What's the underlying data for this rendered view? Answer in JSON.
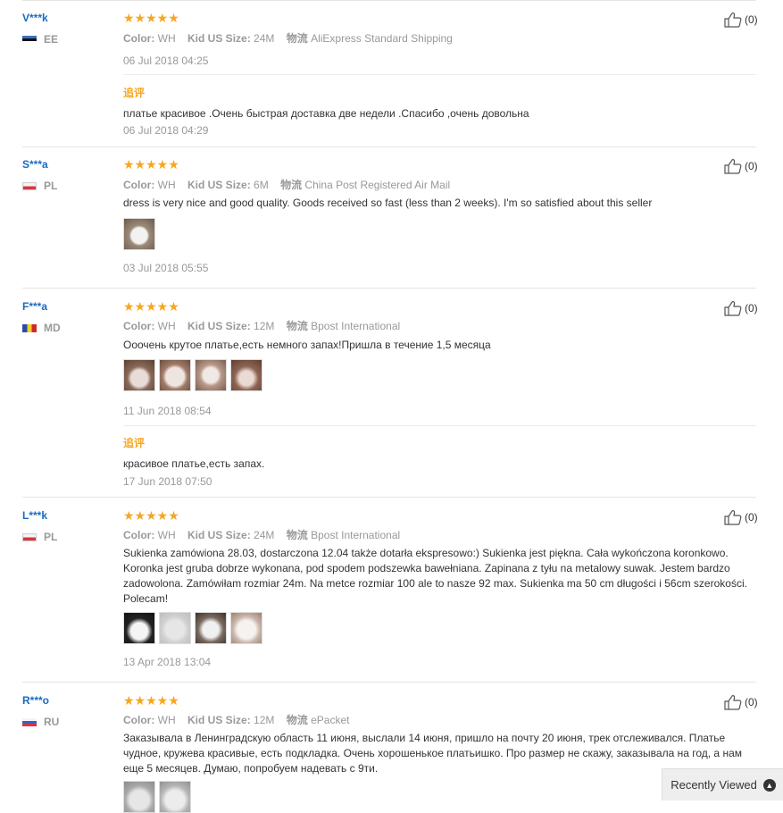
{
  "reviews": [
    {
      "user": "V***k",
      "country": "EE",
      "meta": {
        "color_label": "Color:",
        "color": "WH",
        "size_label": "Kid US Size:",
        "size": "24M",
        "ship_label": "物流",
        "ship": "AliExpress Standard Shipping"
      },
      "text": "",
      "date": "06 Jul 2018 04:25",
      "append_label": "追评",
      "append_text": "платье красивое .Очень быстрая доставка две недели .Спасибо ,очень довольна",
      "append_date": "06 Jul 2018 04:29",
      "helpful": "(0)"
    },
    {
      "user": "S***a",
      "country": "PL",
      "meta": {
        "color_label": "Color:",
        "color": "WH",
        "size_label": "Kid US Size:",
        "size": "6M",
        "ship_label": "物流",
        "ship": "China Post Registered Air Mail"
      },
      "text": "dress is very nice and good quality. Goods received so fast (less than 2 weeks). I'm so satisfied about this seller",
      "date": "03 Jul 2018 05:55",
      "helpful": "(0)"
    },
    {
      "user": "F***a",
      "country": "MD",
      "meta": {
        "color_label": "Color:",
        "color": "WH",
        "size_label": "Kid US Size:",
        "size": "12M",
        "ship_label": "物流",
        "ship": "Bpost International"
      },
      "text": "Ооочень крутое платье,есть немного запах!Пришла в течение 1,5 месяца",
      "date": "11 Jun 2018 08:54",
      "append_label": "追评",
      "append_text": "красивое платье,есть запах.",
      "append_date": "17 Jun 2018 07:50",
      "helpful": "(0)"
    },
    {
      "user": "L***k",
      "country": "PL",
      "meta": {
        "color_label": "Color:",
        "color": "WH",
        "size_label": "Kid US Size:",
        "size": "24M",
        "ship_label": "物流",
        "ship": "Bpost International"
      },
      "text": "Sukienka zamówiona 28.03, dostarczona 12.04 także dotarła ekspresowo:) Sukienka jest piękna. Cała wykończona koronkowo. Koronka jest gruba dobrze wykonana, pod spodem podszewka bawełniana. Zapinana z tyłu na metalowy suwak. Jestem bardzo zadowolona. Zamówiłam rozmiar 24m. Na metce rozmiar 100 ale to nasze 92 max. Sukienka ma 50 cm długości i 56cm szerokości. Polecam!",
      "date": "13 Apr 2018 13:04",
      "helpful": "(0)"
    },
    {
      "user": "R***o",
      "country": "RU",
      "meta": {
        "color_label": "Color:",
        "color": "WH",
        "size_label": "Kid US Size:",
        "size": "12M",
        "ship_label": "物流",
        "ship": "ePacket"
      },
      "text": "Заказывала в Ленинградскую область 11 июня, выслали 14 июня, пришло на почту 20 июня, трек отслеживался. Платье чудное, кружева красивые, есть подкладка. Очень хорошенькое платьишко. Про размер не скажу, заказывала на год, а нам еще 5 месяцев. Думаю, попробуем надевать с 9ти.",
      "helpful": "(0)"
    }
  ],
  "stars": "★★★★★",
  "recently_viewed": "Recently Viewed",
  "colors": {
    "accent": "#f5a623",
    "link": "#1a6ac2",
    "muted": "#999999"
  }
}
